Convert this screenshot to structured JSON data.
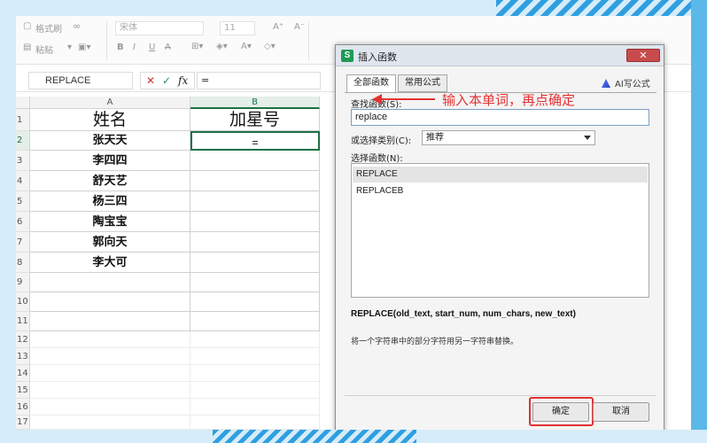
{
  "ribbon": {
    "format_painter": "格式刷",
    "paste": "粘贴",
    "font_name": "宋体",
    "font_size": "11"
  },
  "formula_bar": {
    "name_box": "REPLACE",
    "cancel": "✕",
    "confirm": "✓",
    "fx": "fx",
    "formula": "="
  },
  "grid": {
    "columns": [
      "A",
      "B"
    ],
    "row_numbers": [
      "1",
      "2",
      "3",
      "4",
      "5",
      "6",
      "7",
      "8",
      "9",
      "10",
      "11",
      "12",
      "13",
      "14",
      "15",
      "16",
      "17"
    ],
    "header_a": "姓名",
    "header_b": "加星号",
    "active_cell_value": "=",
    "names": [
      "张天天",
      "李四四",
      "舒天艺",
      "杨三四",
      "陶宝宝",
      "郭向天",
      "李大可"
    ]
  },
  "dialog": {
    "title": "插入函数",
    "app_icon": "S",
    "close": "✕",
    "tabs": [
      "全部函数",
      "常用公式"
    ],
    "ai_label": "AI写公式",
    "search_label": "查找函数(S):",
    "search_value": "replace",
    "category_label": "或选择类别(C):",
    "category_value": "推荐",
    "select_label": "选择函数(N):",
    "functions": [
      "REPLACE",
      "REPLACEB"
    ],
    "signature": "REPLACE(old_text, start_num, num_chars, new_text)",
    "description": "将一个字符串中的部分字符用另一字符串替换。",
    "ok": "确定",
    "cancel": "取消"
  },
  "annotation": {
    "text": "输入本单词，再点确定",
    "color": "#e53232"
  },
  "colors": {
    "accent_green": "#1e7145",
    "highlight_red": "#e03030",
    "frame_blue": "#5bb8e8"
  }
}
